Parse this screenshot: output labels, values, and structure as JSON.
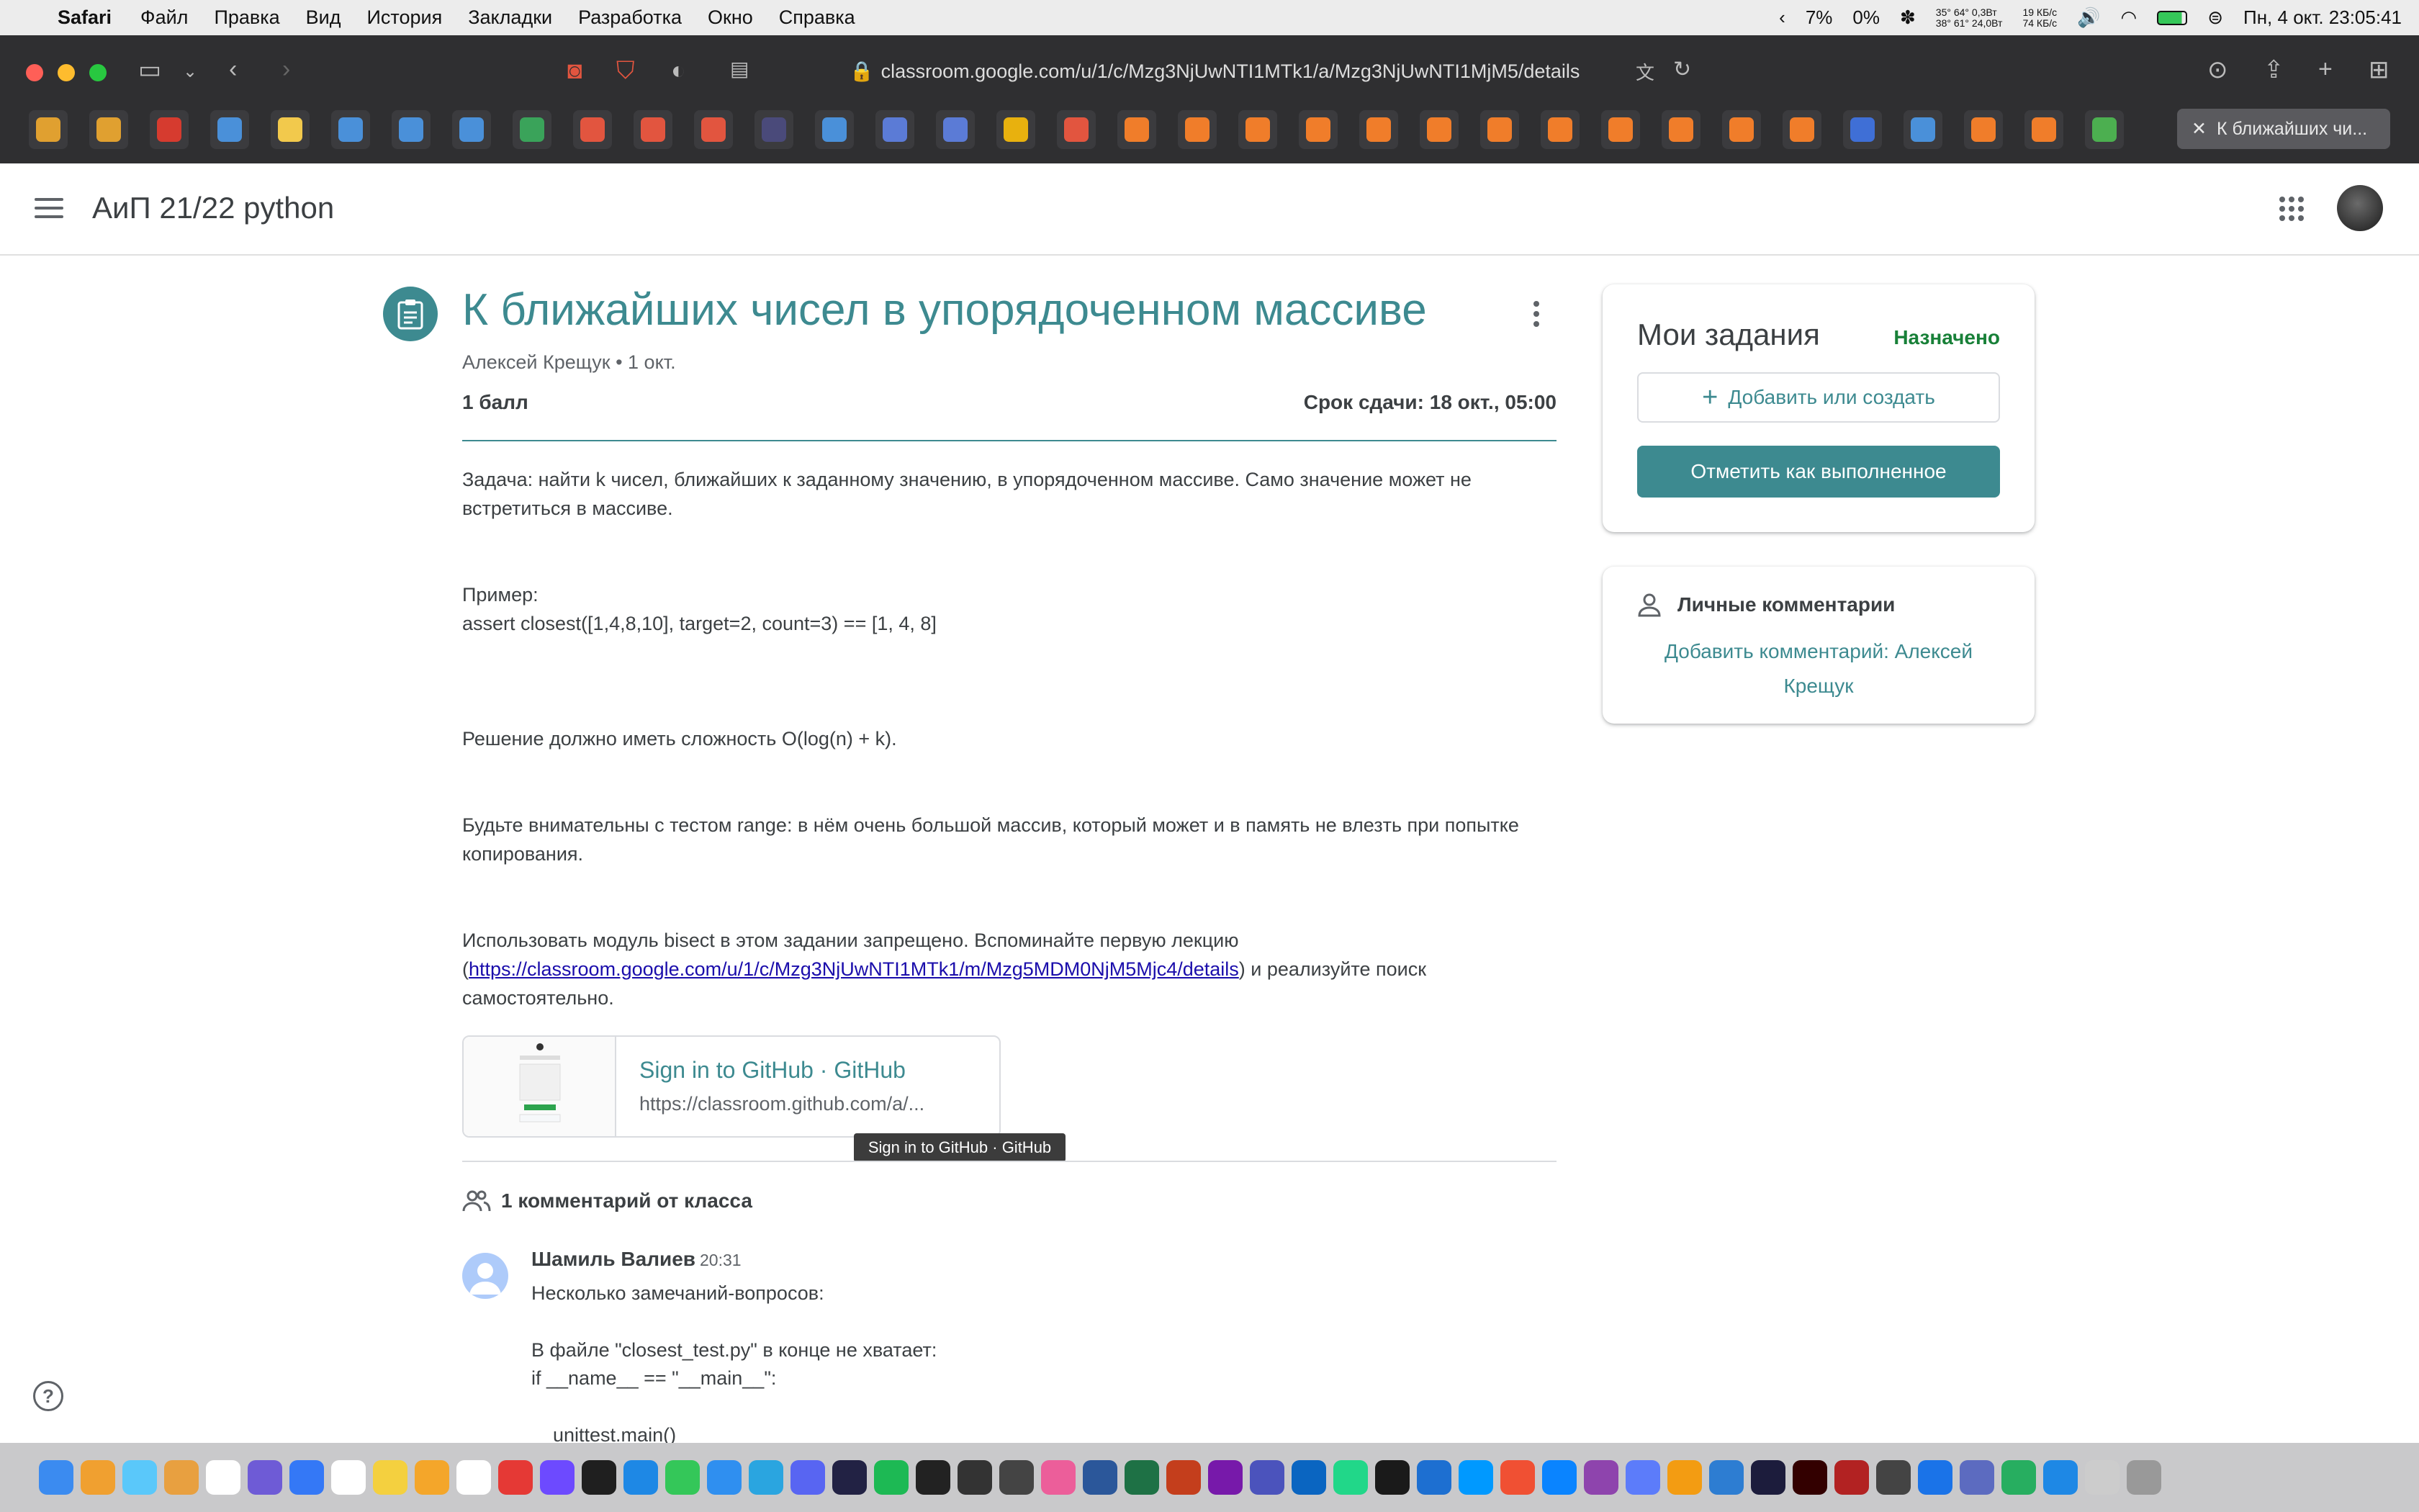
{
  "menubar": {
    "app_name": "Safari",
    "items": [
      "Файл",
      "Правка",
      "Вид",
      "История",
      "Закладки",
      "Разработка",
      "Окно",
      "Справка"
    ],
    "status": {
      "cpu_pct": "7%",
      "gpu_pct": "0%",
      "temps_top": "35° 64° 0,3Вт",
      "temps_bottom": "38° 61° 24,0Вт",
      "net_up": "19 КБ/с",
      "net_down": "74 КБ/с",
      "datetime": "Пн, 4 окт.  23:05:41"
    }
  },
  "browser": {
    "url": "classroom.google.com/u/1/c/Mzg3NjUwNTI1MTk1/a/Mzg3NjUwNTI1MjM5/details",
    "active_tab": "К ближайших чи...",
    "favorite_colors": [
      "#e0a030",
      "#e0a030",
      "#d63b2f",
      "#4a90d9",
      "#f2c94c",
      "#4a90d9",
      "#4a90d9",
      "#4a90d9",
      "#3aa35a",
      "#e2553f",
      "#e2553f",
      "#e2553f",
      "#4a4a7a",
      "#4a90d9",
      "#5b7bd6",
      "#5b7bd6",
      "#e8b10e",
      "#e2553f",
      "#f07d2a",
      "#f07d2a",
      "#f07d2a",
      "#f07d2a",
      "#f07d2a",
      "#f07d2a",
      "#f07d2a",
      "#f07d2a",
      "#f07d2a",
      "#f07d2a",
      "#f07d2a",
      "#f07d2a",
      "#3f6fd6",
      "#4a90d9",
      "#f07d2a",
      "#f07d2a",
      "#4caf50"
    ]
  },
  "classroom": {
    "class_name": "АиП 21/22 python",
    "assignment": {
      "title": "К ближайших чисел в упорядоченном массиве",
      "author_line": "Алексей Крещук • 1 окт.",
      "points": "1 балл",
      "due": "Срок сдачи: 18 окт., 05:00",
      "p1": "Задача: найти k чисел, ближайших к заданному значению, в упорядоченном массиве. Само значение может не встретиться в массиве.",
      "example_label": "Пример:",
      "example_code": "assert closest([1,4,8,10], target=2, count=3) == [1, 4, 8]",
      "complexity": "Решение должно иметь сложность O(log(n) + k).",
      "warning": "Будьте внимательны с тестом range: в нём очень большой массив, который может и в память не влезть при попытке копирования.",
      "bisect_before": "Использовать модуль bisect в этом задании запрещено. Вспоминайте первую лекцию (",
      "lecture_link": "https://classroom.google.com/u/1/c/Mzg3NjUwNTI1MTk1/m/Mzg5MDM0NjM5Mjc4/details",
      "bisect_after": ") и реализуйте поиск самостоятельно.",
      "attachment": {
        "title": "Sign in to GitHub · GitHub",
        "url": "https://classroom.github.com/a/...",
        "tooltip": "Sign in to GitHub · GitHub"
      }
    },
    "comments": {
      "header": "1 комментарий от класса",
      "author": "Шамиль Валиев",
      "time": "20:31",
      "lines": [
        "Несколько замечаний-вопросов:",
        "В файле \"closest_test.py\" в конце не хватает:",
        "if __name__ == \"__main__\":",
        "    unittest.main()"
      ]
    },
    "my_work": {
      "title": "Мои задания",
      "status": "Назначено",
      "add_button": "Добавить или создать",
      "mark_button": "Отметить как выполненное"
    },
    "private_comments": {
      "title": "Личные комментарии",
      "add_link": "Добавить комментарий: Алексей Крещук"
    },
    "help_glyph": "?"
  },
  "dock": {
    "icon_colors": [
      "#3b8bf0",
      "#f0a030",
      "#5ac8fa",
      "#e8a040",
      "#ffffff",
      "#6e5bd6",
      "#3478f6",
      "#ffffff",
      "#f4d03f",
      "#f4a62a",
      "#ffffff",
      "#e53935",
      "#6d4aff",
      "#1f1f1f",
      "#1e88e5",
      "#34c759",
      "#2f8ff0",
      "#2aa5e0",
      "#5865f2",
      "#222244",
      "#1db954",
      "#222222",
      "#333333",
      "#444444",
      "#ec5e9a",
      "#2b579a",
      "#1e7145",
      "#c43e1c",
      "#7719aa",
      "#4b53bc",
      "#0a65c1",
      "#21d789",
      "#1a1a1a",
      "#1d6fd1",
      "#0099ff",
      "#f05033",
      "#0a84ff",
      "#8e44ad",
      "#5c7cfa",
      "#f39c12",
      "#2d7dd2",
      "#1c1c3c",
      "#330000",
      "#b22222",
      "#444444",
      "#1a73e8",
      "#5c6bc0",
      "#27ae60",
      "#1e88e5",
      "#cccccc",
      "#999999"
    ]
  }
}
